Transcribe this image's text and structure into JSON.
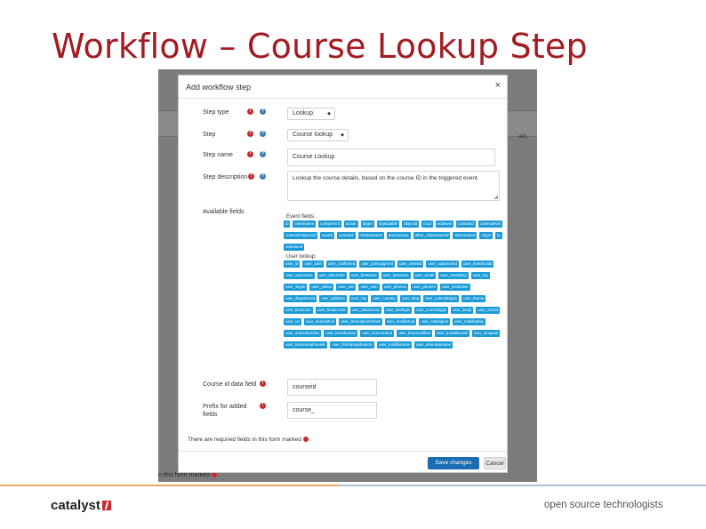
{
  "slide": {
    "title": "Workflow – Course Lookup Step",
    "logo_text": "catalyst",
    "tagline": "open source technologists"
  },
  "background": {
    "right_text": "ect.",
    "footer_note": "n this form marked"
  },
  "modal": {
    "title": "Add workflow step",
    "close_glyph": "×",
    "step_type": {
      "label": "Step type",
      "value": "Lookup"
    },
    "step": {
      "label": "Step",
      "value": "Course lookup"
    },
    "step_name": {
      "label": "Step name",
      "value": "Course Lookup"
    },
    "step_description": {
      "label": "Step description",
      "value": "Lookup the course details, based on the course ID in the triggered event."
    },
    "available_fields": {
      "label": "Available fields",
      "event_group_title": "Event fields:",
      "event_fields": [
        "id",
        "eventname",
        "component",
        "action",
        "target",
        "objecttable",
        "objectid",
        "crud",
        "edulevel",
        "contextid",
        "contextlevel",
        "contextinstanceid",
        "userid",
        "courseid",
        "relateduserid",
        "anonymous",
        "other_relateduserid",
        "timecreated",
        "origin",
        "ip",
        "realuserid"
      ],
      "user_group_title": "User lookup:",
      "user_fields": [
        "user_id",
        "user_auth",
        "user_confirmed",
        "user_policyagreed",
        "user_deleted",
        "user_suspended",
        "user_mnethostid",
        "user_username",
        "user_idnumber",
        "user_firstname",
        "user_lastname",
        "user_email",
        "user_emailstop",
        "user_icq",
        "user_skype",
        "user_yahoo",
        "user_aim",
        "user_msn",
        "user_phone1",
        "user_phone2",
        "user_institution",
        "user_department",
        "user_address",
        "user_city",
        "user_country",
        "user_lang",
        "user_calendartype",
        "user_theme",
        "user_timezone",
        "user_firstaccess",
        "user_lastaccess",
        "user_lastlogin",
        "user_currentlogin",
        "user_lastip",
        "user_secret",
        "user_url",
        "user_description",
        "user_descriptionformat",
        "user_mailformat",
        "user_maildigest",
        "user_maildisplay",
        "user_autosubscribe",
        "user_trackforums",
        "user_timecreated",
        "user_timemodified",
        "user_trustbitmask",
        "user_imagealt",
        "user_lastnamephonetic",
        "user_firstnamephonetic",
        "user_middlename",
        "user_alternatename"
      ]
    },
    "course_id_field": {
      "label": "Course id data field",
      "value": "courseid"
    },
    "prefix": {
      "label": "Prefix for added fields",
      "value": "course_"
    },
    "required_note": "There are required fields in this form marked",
    "buttons": {
      "save": "Save changes",
      "cancel": "Cancel"
    }
  },
  "colors": {
    "title": "#a31b23",
    "tag": "#1a9bd7",
    "primary": "#1b6cb3",
    "required": "#c8282e",
    "help": "#3a7bb8"
  }
}
